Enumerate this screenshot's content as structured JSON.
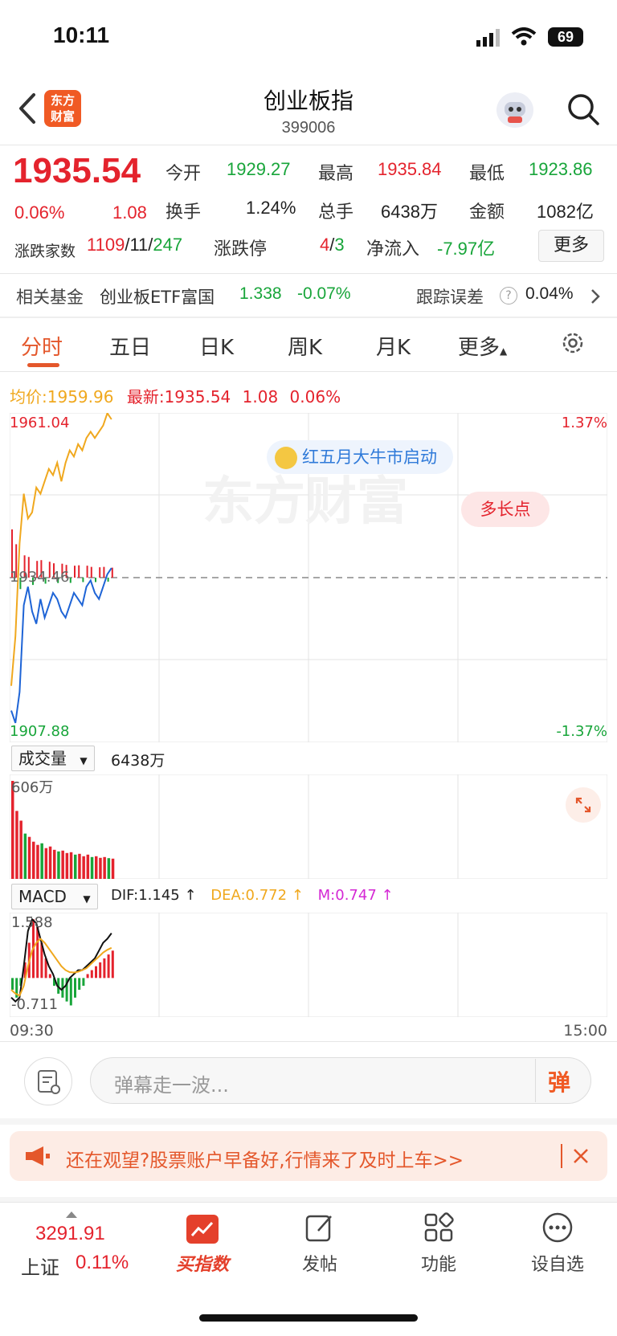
{
  "status": {
    "time": "10:11",
    "battery": "69"
  },
  "header": {
    "title": "创业板指",
    "code": "399006",
    "logo_text": "东方\n财富"
  },
  "quote": {
    "price": "1935.54",
    "change_pct": "0.06%",
    "change": "1.08",
    "open_label": "今开",
    "open": "1929.27",
    "high_label": "最高",
    "high": "1935.84",
    "low_label": "最低",
    "low": "1923.86",
    "turnover_label": "换手",
    "turnover": "1.24%",
    "volume_label": "总手",
    "volume": "6438万",
    "amount_label": "金额",
    "amount": "1082亿",
    "breadth_label": "涨跌家数",
    "breadth_up": "1109",
    "breadth_flat": "11",
    "breadth_down": "247",
    "breadth_sep": "/",
    "limit_label": "涨跌停",
    "limit_up": "4",
    "limit_down": "3",
    "netflow_label": "净流入",
    "netflow": "-7.97亿",
    "more": "更多"
  },
  "fund": {
    "label": "相关基金",
    "name": "创业板ETF富国",
    "price": "1.338",
    "change": "-0.07%",
    "error_label": "跟踪误差",
    "error_help": "?",
    "error": "0.04%"
  },
  "tabs": [
    "分时",
    "五日",
    "日K",
    "周K",
    "月K",
    "更多"
  ],
  "legend": {
    "avg_label": "均价:",
    "avg": "1959.96",
    "last_label": "最新:",
    "last": "1935.54",
    "change": "1.08",
    "pct": "0.06%"
  },
  "chart_axes": {
    "y_top": "1961.04",
    "y_mid": "1934.46",
    "y_bottom": "1907.88",
    "pct_top": "1.37%",
    "pct_bottom": "-1.37%",
    "time_start": "09:30",
    "time_end": "15:00"
  },
  "watermark": "东方财富",
  "promo_bubble": "红五月大牛市启动",
  "long_short": "多长点",
  "volume_panel": {
    "selector": "成交量",
    "value": "6438万",
    "max": "606万"
  },
  "macd_panel": {
    "selector": "MACD",
    "dif": "DIF:1.145 ↑",
    "dea": "DEA:0.772 ↑",
    "m": "M:0.747 ↑",
    "max": "1.588",
    "min": "-0.711"
  },
  "comment": {
    "placeholder": "弹幕走一波...",
    "danmu": "弹"
  },
  "banner": {
    "text": "还在观望?股票账户早备好,行情来了及时上车>>"
  },
  "bottom_nav": {
    "index_price": "3291.91",
    "index_name": "上证",
    "index_pct": "0.11%",
    "items": [
      "买指数",
      "发帖",
      "功能",
      "设自选"
    ]
  },
  "chart_data": {
    "type": "line",
    "title": "",
    "xlabel": "",
    "ylabel": "",
    "ylim": [
      1907.88,
      1961.04
    ],
    "series": [
      {
        "name": "均价",
        "values": [
          1913,
          1911,
          1916,
          1930,
          1933,
          1929,
          1927,
          1931,
          1928,
          1930,
          1932,
          1931,
          1929,
          1928,
          1930,
          1932,
          1931,
          1930,
          1933,
          1934,
          1932,
          1931,
          1933,
          1935,
          1936
        ]
      },
      {
        "name": "最新",
        "values": [
          1917,
          1925,
          1940,
          1948,
          1944,
          1945,
          1949,
          1948,
          1950,
          1952,
          1951,
          1953,
          1950,
          1953,
          1955,
          1954,
          1956,
          1955,
          1957,
          1958,
          1957,
          1958,
          1959,
          1961,
          1960
        ]
      }
    ],
    "volume": [
      606,
      420,
      360,
      280,
      260,
      230,
      210,
      220,
      190,
      200,
      180,
      170,
      175,
      160,
      165,
      150,
      155,
      140,
      150,
      135,
      140,
      130,
      135,
      128,
      125
    ],
    "macd_hist": [
      -0.3,
      -0.5,
      -0.2,
      0.4,
      0.9,
      1.5,
      1.3,
      0.9,
      0.5,
      0.1,
      -0.2,
      -0.4,
      -0.5,
      -0.6,
      -0.7,
      -0.5,
      -0.3,
      -0.2,
      0.1,
      0.2,
      0.3,
      0.4,
      0.5,
      0.6,
      0.7
    ],
    "dif": [
      -0.5,
      -0.6,
      -0.5,
      0.3,
      1.2,
      1.5,
      1.4,
      1.0,
      0.6,
      0.3,
      0.1,
      -0.2,
      -0.3,
      -0.2,
      0.0,
      0.1,
      0.2,
      0.2,
      0.3,
      0.4,
      0.5,
      0.7,
      0.9,
      1.0,
      1.145
    ],
    "dea": [
      -0.3,
      -0.4,
      -0.45,
      -0.2,
      0.3,
      0.7,
      0.9,
      1.0,
      0.9,
      0.75,
      0.6,
      0.45,
      0.3,
      0.2,
      0.15,
      0.14,
      0.16,
      0.2,
      0.25,
      0.35,
      0.45,
      0.55,
      0.65,
      0.72,
      0.772
    ]
  }
}
